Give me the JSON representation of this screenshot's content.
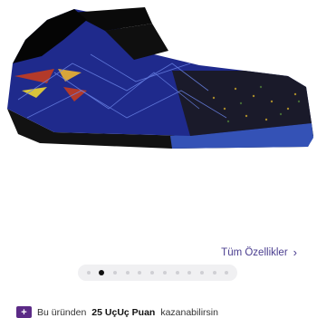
{
  "gallery": {
    "image_alt_icon": "kids-football-shoe-image",
    "dots_count": 12,
    "active_index": 1
  },
  "features_link": {
    "label": "Tüm Özellikler",
    "icon": "chevron-right-icon"
  },
  "promo": {
    "icon": "plus-badge-icon",
    "prefix": "Bu üründen",
    "points": "25 UçUç Puan",
    "suffix": "kazanabilirsin"
  },
  "colors": {
    "accent": "#4a3d8f",
    "promo_badge": "#5b2a86"
  }
}
